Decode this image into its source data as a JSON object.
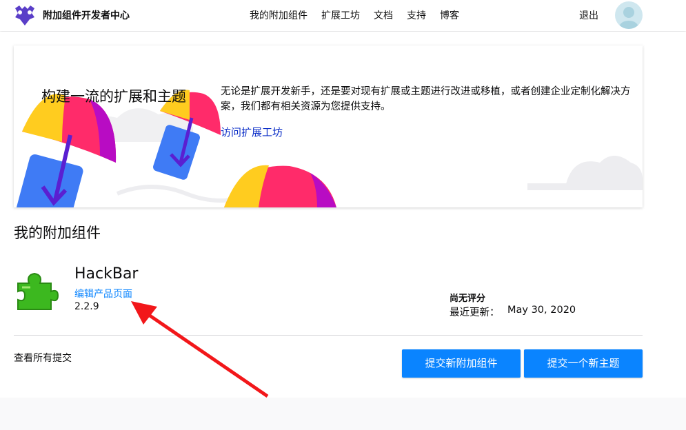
{
  "header": {
    "brand": "附加组件开发者中心",
    "nav": [
      "我的附加组件",
      "扩展工坊",
      "文档",
      "支持",
      "博客"
    ],
    "logout": "退出"
  },
  "banner": {
    "title": "构建一流的扩展和主题",
    "description": "无论是扩展开发新手，还是要对现有扩展或主题进行改进或移植，或者创建企业定制化解决方案，我们都有相关资源为您提供支持。",
    "link": "访问扩展工坊"
  },
  "addons": {
    "section_title": "我的附加组件",
    "items": [
      {
        "name": "HackBar",
        "edit_link": "编辑产品页面",
        "version": "2.2.9",
        "rating": "尚无评分",
        "updated_label": "最近更新：",
        "updated_value": "May 30, 2020"
      }
    ],
    "view_all": "查看所有提交",
    "submit_addon": "提交新附加组件",
    "submit_theme": "提交一个新主题"
  },
  "colors": {
    "accent": "#0a84ff",
    "link": "#0a2dc7",
    "annotation_arrow": "#f2171a"
  }
}
